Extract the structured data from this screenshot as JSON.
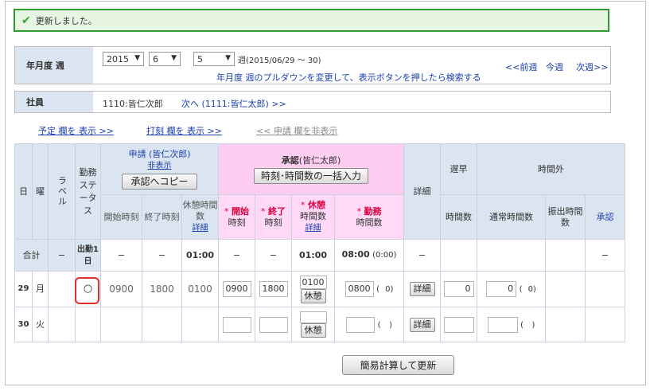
{
  "message": "更新しました。",
  "period": {
    "label": "年月度 週",
    "year": "2015",
    "month": "6",
    "week": "5",
    "week_range": "週(2015/06/29 〜 30)",
    "hint": "年月度 週のプルダウンを変更して、表示ボタンを押したら検索する",
    "prev": "<<前週",
    "current": "今週",
    "next": "次週>>"
  },
  "employee": {
    "label": "社員",
    "value": "1110:皆仁次郎",
    "next_link": "次へ (1111:皆仁太郎) >>"
  },
  "toggles": {
    "schedule": "予定 欄を 表示 >>",
    "stamp": "打刻 欄を 表示 >>",
    "request": "<< 申請 欄を非表示"
  },
  "header": {
    "day": "日",
    "weekday": "曜",
    "label": "ラベル",
    "status": "勤務ステータス",
    "request_title": "申請 (皆仁次郎)",
    "hide": "非表示",
    "copy_btn": "承認へコピー",
    "req_start": "開始時刻",
    "req_end": "終了時刻",
    "req_break": "休憩時間数",
    "req_break_detail": "詳細",
    "approve_title_bold": "承認",
    "approve_title_rest": "(皆仁太郎)",
    "bulk_btn": "時刻･時間数の一括入力",
    "ap_start_bold": "開始",
    "ap_start_rest": "時刻",
    "ap_end_bold": "終了",
    "ap_end_rest": "時刻",
    "ap_break_bold": "休憩",
    "ap_break_rest": "時間数",
    "ap_break_detail": "詳細",
    "ap_work_bold": "勤務",
    "ap_work_rest": "時間数",
    "detail": "詳細",
    "late": "遅早",
    "late_hours": "時間数",
    "overtime": "時間外",
    "normal": "通常時間数",
    "transfer": "振出時間数",
    "approve": "承認",
    "star": "*"
  },
  "total": {
    "label": "合計",
    "label_col": "−",
    "status": "出勤1日",
    "req_start": "−",
    "req_end": "−",
    "req_break": "01:00",
    "ap_start": "−",
    "ap_end": "−",
    "ap_break": "01:00",
    "ap_work": "08:00",
    "ap_work_paren": "(0:00)",
    "detail": "−",
    "approve": "−"
  },
  "rows": [
    {
      "day": "29",
      "weekday": "月",
      "status_mark": "○",
      "req_start": "0900",
      "req_end": "1800",
      "req_break": "0100",
      "ap_start": "0900",
      "ap_end": "1800",
      "ap_break": "0100",
      "break_btn": "休憩",
      "ap_work": "0800",
      "paren_open": "(",
      "paren_val": "0)",
      "detail_btn": "詳細",
      "late": "0",
      "normal": "0",
      "normal_paren": "(",
      "normal_paren_val": "0)"
    },
    {
      "day": "30",
      "weekday": "火",
      "status_mark": "",
      "req_start": "",
      "req_end": "",
      "req_break": "",
      "ap_start": "",
      "ap_end": "",
      "ap_break": "",
      "break_btn": "休憩",
      "ap_work": "",
      "paren_open": "(",
      "paren_val": ")",
      "detail_btn": "詳細",
      "late": "",
      "normal": "",
      "normal_paren": "(",
      "normal_paren_val": ")"
    }
  ],
  "calc_button": "簡易計算して更新"
}
